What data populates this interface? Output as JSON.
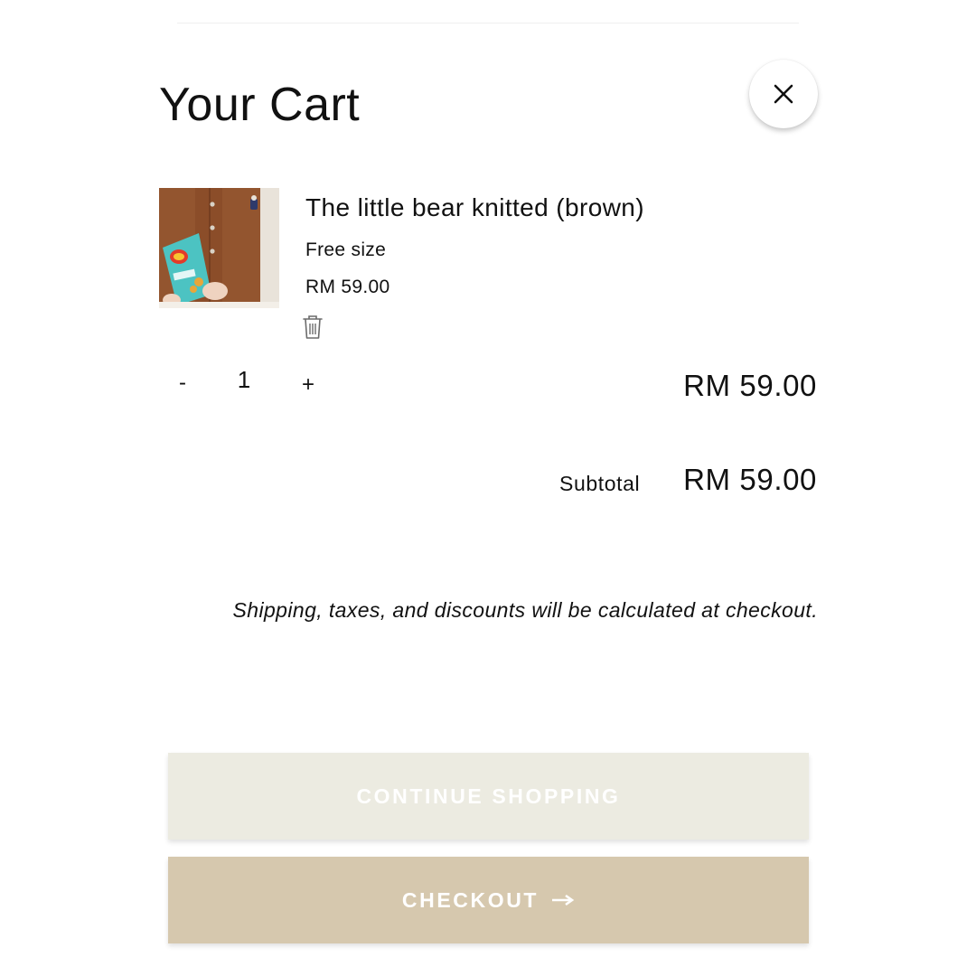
{
  "cart": {
    "title": "Your Cart",
    "close_icon": "close-icon"
  },
  "item": {
    "name": "The little bear knitted (brown)",
    "variant": "Free size",
    "price": "RM 59.00",
    "quantity": "1",
    "minus_label": "-",
    "plus_label": "+",
    "line_total": "RM 59.00",
    "remove_icon": "trash-icon",
    "thumbnail_color": "#8a4f2e"
  },
  "summary": {
    "subtotal_label": "Subtotal",
    "subtotal_value": "RM 59.00",
    "shipping_note": "Shipping, taxes, and discounts will be calculated at checkout."
  },
  "buttons": {
    "continue_label": "CONTINUE SHOPPING",
    "continue_color": "#ecebe1",
    "checkout_label": "CHECKOUT",
    "checkout_color": "#d6c8ae",
    "checkout_icon": "arrow-right-icon"
  }
}
